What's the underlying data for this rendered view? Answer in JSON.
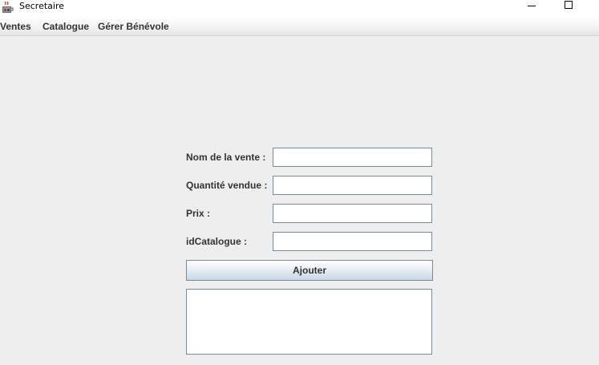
{
  "window": {
    "title": "Secretaire",
    "icon": "java-coffee-cup-icon",
    "controls": [
      "minimize-icon",
      "maximize-icon"
    ]
  },
  "menu": {
    "items": [
      {
        "label": "Ventes"
      },
      {
        "label": "Catalogue"
      },
      {
        "label": "Gérer Bénévole"
      }
    ]
  },
  "form": {
    "fields": [
      {
        "label": "Nom de la vente :",
        "value": ""
      },
      {
        "label": "Quantité vendue :",
        "value": ""
      },
      {
        "label": "Prix :",
        "value": ""
      },
      {
        "label": "idCatalogue :",
        "value": ""
      }
    ],
    "submit_label": "Ajouter",
    "output_text": ""
  },
  "colors": {
    "background": "#eeeeee",
    "field_border": "#7a8a99",
    "label_text": "#333333"
  }
}
